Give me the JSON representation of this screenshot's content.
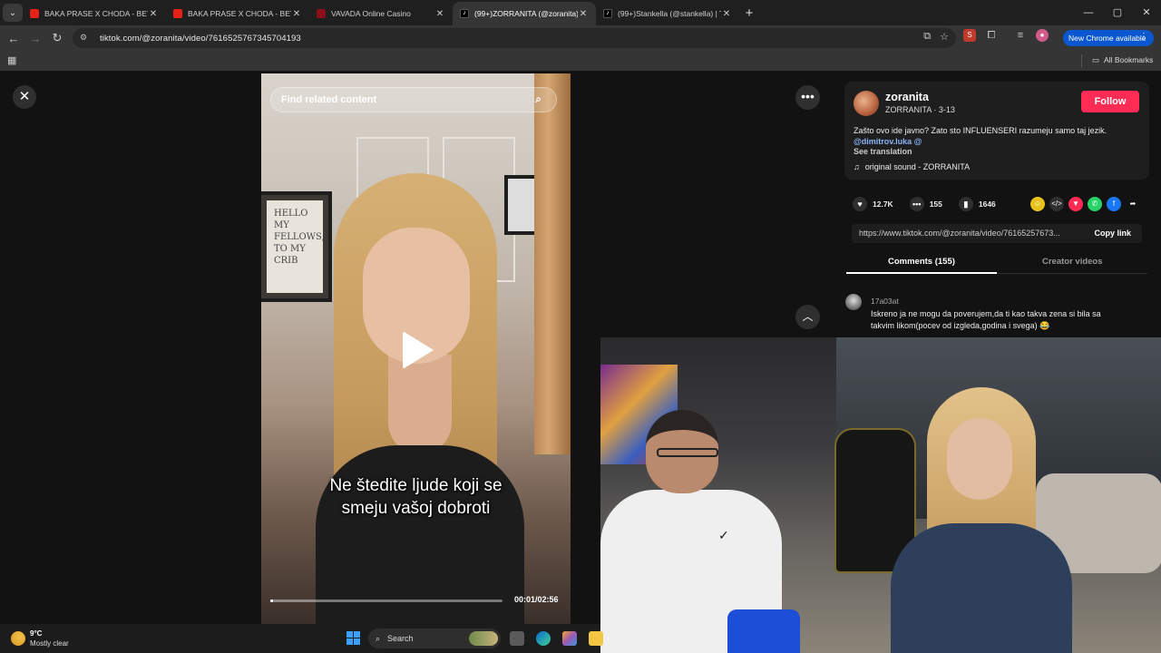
{
  "browser": {
    "tabs": [
      {
        "title": "BAKA PRASE X CHODA - BETMI",
        "favicon": "youtube-icon",
        "active": false
      },
      {
        "title": "BAKA PRASE X CHODA - BETMI",
        "favicon": "youtube-icon",
        "active": false
      },
      {
        "title": "VAVADA Online Casino",
        "favicon": "vavada-icon",
        "active": false
      },
      {
        "title": "(99+)ZORRANITA (@zoranita) |",
        "favicon": "tiktok-icon",
        "active": true
      },
      {
        "title": "(99+)Stankella (@stankella) | Ti",
        "favicon": "tiktok-icon",
        "active": false
      }
    ],
    "url": "tiktok.com/@zoranita/video/7616525767345704193",
    "new_chrome_label": "New Chrome available",
    "all_bookmarks_label": "All Bookmarks"
  },
  "video": {
    "search_placeholder": "Find related content",
    "caption_line1": "Ne štedite ljude koji se",
    "caption_line2": "smeju vašoj dobroti",
    "time": "00:01/02:56",
    "progress_fraction": 0.006,
    "frame_text": "HELLO MY FELLOWS, TO MY CRIB"
  },
  "post": {
    "username": "zoranita",
    "nickname": "ZORRANITA",
    "date": "3-13",
    "follow_label": "Follow",
    "description": "Zašto ovo ide javno? Zato sto INFLUENSERI razumeju samo taj jezik.",
    "mention1": "@dimitrov.luka",
    "mention2": "@",
    "see_translation": "See translation",
    "sound": "original sound - ZORRANITA",
    "likes": "12.7K",
    "comments": "155",
    "saves": "1646",
    "link": "https://www.tiktok.com/@zoranita/video/76165257673...",
    "copy_link_label": "Copy link",
    "tab_comments": "Comments (155)",
    "tab_creator": "Creator videos"
  },
  "comment": {
    "user": "17a03at",
    "text": "Iskreno ja ne mogu da poverujem,da ti kao takva zena si bila sa takvim likom(pocev od izgleda,godina i svega) 😂"
  },
  "taskbar": {
    "temperature": "9°C",
    "condition": "Mostly clear",
    "search_label": "Search"
  }
}
